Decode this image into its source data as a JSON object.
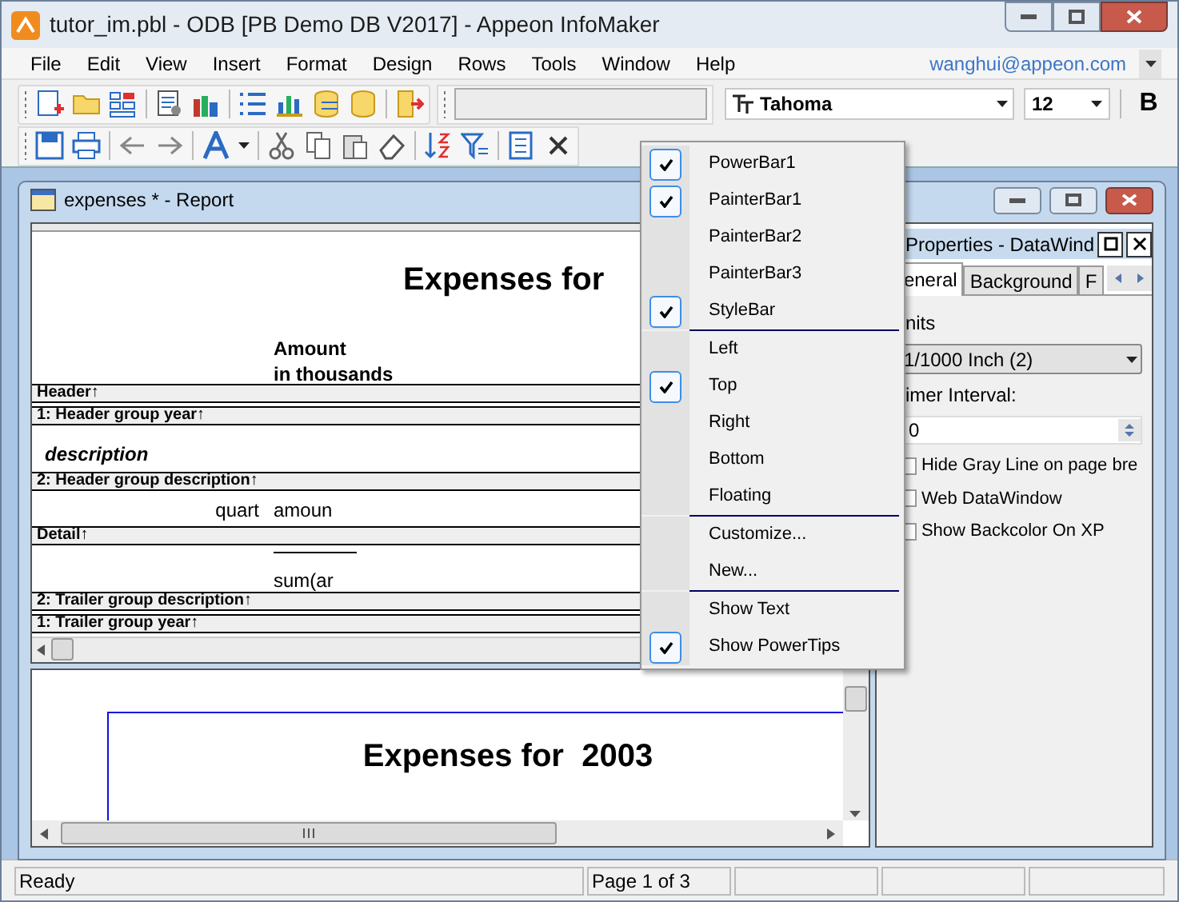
{
  "window": {
    "title": "tutor_im.pbl - ODB [PB Demo DB V2017]  - Appeon InfoMaker"
  },
  "menu_bar": {
    "items": [
      "File",
      "Edit",
      "View",
      "Insert",
      "Format",
      "Design",
      "Rows",
      "Tools",
      "Window",
      "Help"
    ],
    "user": "wanghui@appeon.com"
  },
  "style_bar": {
    "font": "Tahoma",
    "size": "12",
    "bold": "B"
  },
  "child_window": {
    "title": "expenses * - Report"
  },
  "design": {
    "title": "Expenses for",
    "column_label": "Amount",
    "column_label_2": "in thousands",
    "bands": [
      {
        "kind": "band",
        "label": "Header↑"
      },
      {
        "kind": "band",
        "label": "1: Header group year↑"
      },
      {
        "kind": "group_header",
        "text": "description"
      },
      {
        "kind": "band",
        "label": "2: Header group description↑"
      },
      {
        "kind": "detail",
        "left": "quart",
        "right": "amoun"
      },
      {
        "kind": "band",
        "label": "Detail↑"
      },
      {
        "kind": "summary",
        "text": "sum(ar"
      },
      {
        "kind": "band",
        "label": "2: Trailer group description↑"
      },
      {
        "kind": "band",
        "label": "1: Trailer group year↑"
      }
    ]
  },
  "preview": {
    "title": "Expenses for  2003"
  },
  "properties": {
    "title": "Properties - DataWind",
    "tabs": [
      {
        "label": "eneral",
        "selected": true
      },
      {
        "label": "Background",
        "selected": false
      },
      {
        "label": "F",
        "selected": false
      }
    ],
    "units_label": "nits",
    "units_value": "1/1000 Inch (2)",
    "timer_label": "imer Interval:",
    "timer_value": "0",
    "checkboxes": [
      {
        "label": "Hide Gray Line on page bre",
        "checked": false
      },
      {
        "label": "Web DataWindow",
        "checked": false
      },
      {
        "label": "Show Backcolor On XP",
        "checked": false
      }
    ]
  },
  "context_menu": {
    "groups": [
      [
        {
          "label": "PowerBar1",
          "checked": true
        },
        {
          "label": "PainterBar1",
          "checked": true
        },
        {
          "label": "PainterBar2",
          "checked": false
        },
        {
          "label": "PainterBar3",
          "checked": false
        },
        {
          "label": "StyleBar",
          "checked": true
        }
      ],
      [
        {
          "label": "Left",
          "checked": false
        },
        {
          "label": "Top",
          "checked": true
        },
        {
          "label": "Right",
          "checked": false
        },
        {
          "label": "Bottom",
          "checked": false
        },
        {
          "label": "Floating",
          "checked": false
        }
      ],
      [
        {
          "label": "Customize...",
          "checked": false
        },
        {
          "label": "New...",
          "checked": false
        }
      ],
      [
        {
          "label": "Show Text",
          "checked": false
        },
        {
          "label": "Show PowerTips",
          "checked": true
        }
      ]
    ]
  },
  "status_bar": {
    "panes": [
      "Ready",
      "Page 1 of 3"
    ]
  }
}
